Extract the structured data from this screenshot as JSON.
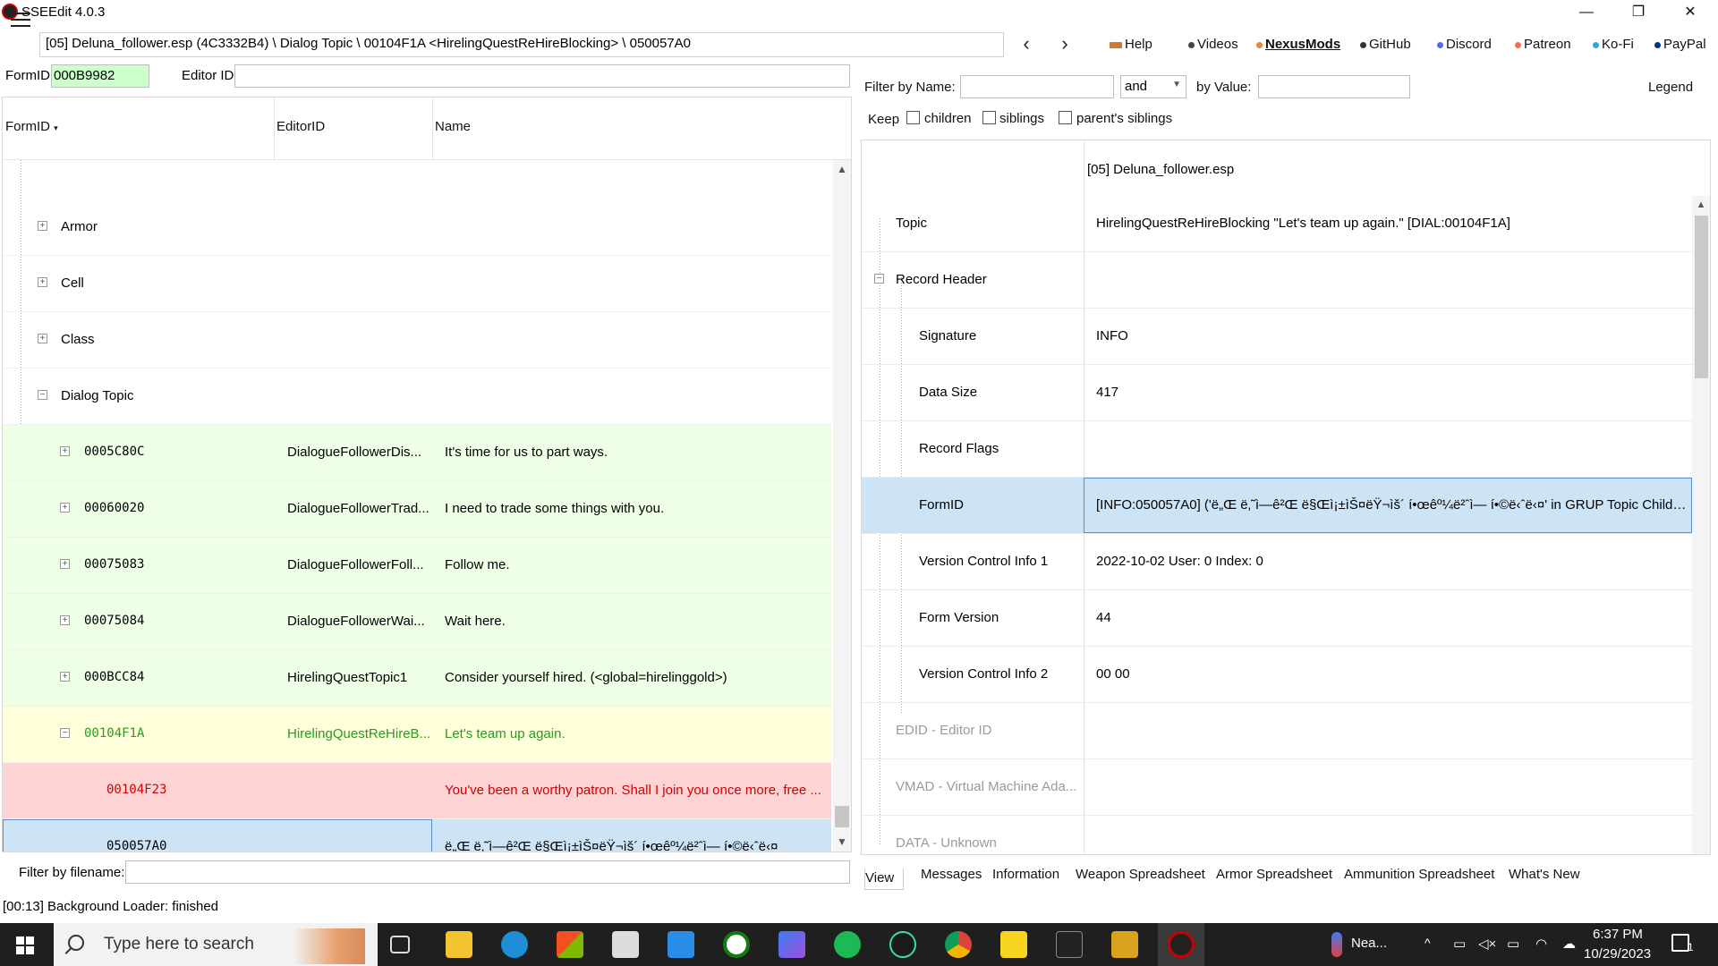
{
  "window": {
    "title": "SSEEdit 4.0.3",
    "minimize": "—",
    "restore": "❐",
    "close": "✕"
  },
  "toolbar": {
    "path": "[05] Deluna_follower.esp (4C3332B4) \\ Dialog Topic \\ 00104F1A <HirelingQuestReHireBlocking> \\ 050057A0",
    "back": "‹",
    "forward": "›",
    "links": [
      {
        "label": "Help",
        "color": "#c97a3a"
      },
      {
        "label": "Videos",
        "color": "#444444"
      },
      {
        "label": "NexusMods",
        "color": "#e8892b"
      },
      {
        "label": "GitHub",
        "color": "#333333"
      },
      {
        "label": "Discord",
        "color": "#5865f2"
      },
      {
        "label": "Patreon",
        "color": "#f96854"
      },
      {
        "label": "Ko-Fi",
        "color": "#29abe0"
      },
      {
        "label": "PayPal",
        "color": "#003087"
      }
    ]
  },
  "left": {
    "formid_label": "FormID",
    "formid_value": "000B9982",
    "editorid_label": "Editor ID",
    "columns": [
      "FormID",
      "EditorID",
      "Name"
    ],
    "groups": [
      "Armor",
      "Cell",
      "Class",
      "Dialog Topic"
    ],
    "rows": [
      {
        "formid": "0005C80C",
        "editorid": "DialogueFollowerDis...",
        "name": "It's time for us to part ways."
      },
      {
        "formid": "00060020",
        "editorid": "DialogueFollowerTrad...",
        "name": "I need to trade some things with you."
      },
      {
        "formid": "00075083",
        "editorid": "DialogueFollowerFoll...",
        "name": "Follow me."
      },
      {
        "formid": "00075084",
        "editorid": "DialogueFollowerWai...",
        "name": "Wait here."
      },
      {
        "formid": "000BCC84",
        "editorid": "HirelingQuestTopic1",
        "name": "Consider yourself hired. (<global=hirelinggold>)"
      },
      {
        "formid": "00104F1A",
        "editorid": "HirelingQuestReHireB...",
        "name": "Let's team up again."
      },
      {
        "formid": "00104F23",
        "editorid": "",
        "name": "You've been a worthy patron. Shall I join you once more, free ..."
      },
      {
        "formid": "050057A0",
        "editorid": "",
        "name": "ë„Œ ë‚˜ì—ê²Œ ë§Œì¡±ìŠ¤ëŸ¬ìš´ í•œêº¼ë²ˆì— í•©ë‹ˆë‹¤"
      }
    ],
    "filter_label": "Filter by filename:",
    "colors": {
      "green_bg": "#efffe6",
      "yellow_bg": "#ffffdc",
      "red_bg": "#ffd4d4",
      "sel_bg": "#cde4f7",
      "green_text": "#2a9a20",
      "red_text": "#d40000"
    }
  },
  "right": {
    "filter_name_label": "Filter by Name:",
    "and_select": "and",
    "by_value_label": "by Value:",
    "legend": "Legend",
    "keep_label": "Keep",
    "keep_children": "children",
    "keep_siblings": "siblings",
    "keep_parent_siblings": "parent's siblings",
    "file_header": "[05] Deluna_follower.esp",
    "rows": [
      {
        "key": "Topic",
        "value": "HirelingQuestReHireBlocking \"Let's team up again.\" [DIAL:00104F1A]"
      },
      {
        "key": "Record Header",
        "value": ""
      },
      {
        "key": "Signature",
        "value": "INFO"
      },
      {
        "key": "Data Size",
        "value": "417"
      },
      {
        "key": "Record Flags",
        "value": ""
      },
      {
        "key": "FormID",
        "value": "[INFO:050057A0] ('ë„Œ ë‚˜ì—ê²Œ ë§Œì¡±ìŠ¤ëŸ¬ìš´ í•œêº¼ë²ˆì— í•©ë‹ˆë‹¤' in GRUP Topic Childre..."
      },
      {
        "key": "Version Control Info 1",
        "value": "2022-10-02 User: 0 Index: 0"
      },
      {
        "key": "Form Version",
        "value": "44"
      },
      {
        "key": "Version Control Info 2",
        "value": "00 00"
      },
      {
        "key": "EDID - Editor ID",
        "value": ""
      },
      {
        "key": "VMAD - Virtual Machine Ada...",
        "value": ""
      },
      {
        "key": "DATA - Unknown",
        "value": ""
      }
    ],
    "tabs": [
      "View",
      "Messages",
      "Information",
      "Weapon Spreadsheet",
      "Armor Spreadsheet",
      "Ammunition Spreadsheet",
      "What's New"
    ]
  },
  "status": "[00:13] Background Loader: finished",
  "taskbar": {
    "search_placeholder": "Type here to search",
    "weather": "Nea...",
    "time": "6:37 PM",
    "date": "10/29/2023",
    "notification_count": "1"
  }
}
